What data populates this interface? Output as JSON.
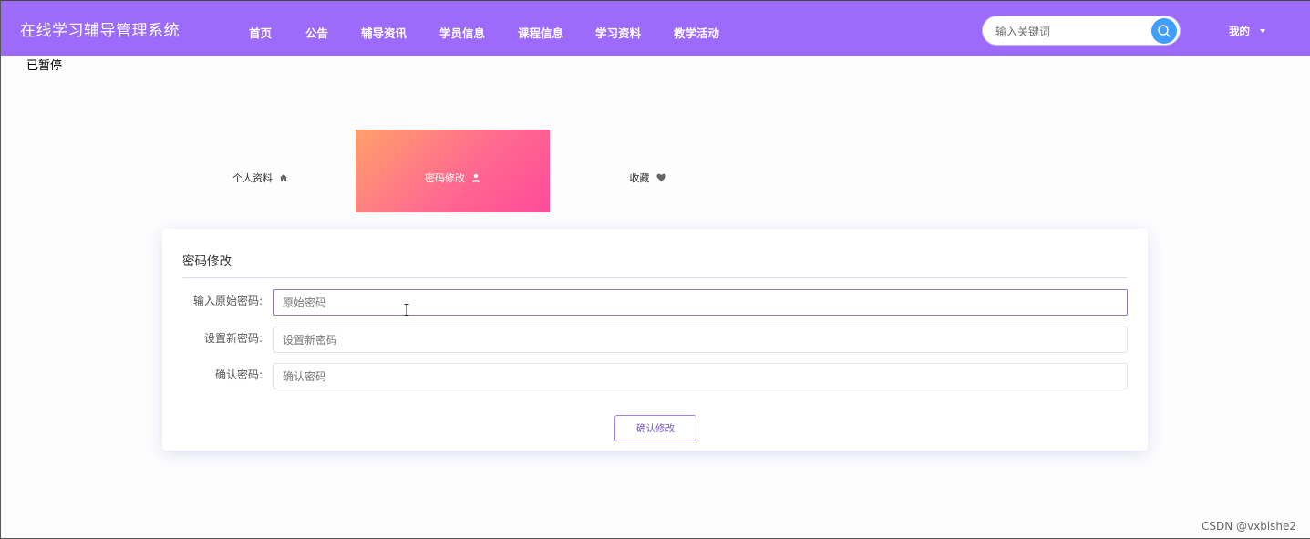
{
  "header": {
    "site_title": "在线学习辅导管理系统",
    "nav": [
      "首页",
      "公告",
      "辅导资讯",
      "学员信息",
      "课程信息",
      "学习资料",
      "教学活动"
    ],
    "search_placeholder": "输入关键词",
    "my_menu_label": "我的"
  },
  "stray_text": "已暂停",
  "tabs": [
    {
      "label": "个人资料",
      "icon": "home-icon",
      "active": false
    },
    {
      "label": "密码修改",
      "icon": "user-icon",
      "active": true
    },
    {
      "label": "收藏",
      "icon": "heart-icon",
      "active": false
    }
  ],
  "card": {
    "title": "密码修改",
    "fields": [
      {
        "label": "输入原始密码:",
        "placeholder": "原始密码",
        "value": ""
      },
      {
        "label": "设置新密码:",
        "placeholder": "设置新密码",
        "value": ""
      },
      {
        "label": "确认密码:",
        "placeholder": "确认密码",
        "value": ""
      }
    ],
    "submit_label": "确认修改"
  },
  "watermark": "CSDN @vxbishe2",
  "colors": {
    "header_bg": "#9c6bfb",
    "active_tab_gradient_start": "#ffa06c",
    "active_tab_gradient_end": "#ff4a9a",
    "search_button": "#409eff",
    "submit_border": "#a67ee8"
  }
}
